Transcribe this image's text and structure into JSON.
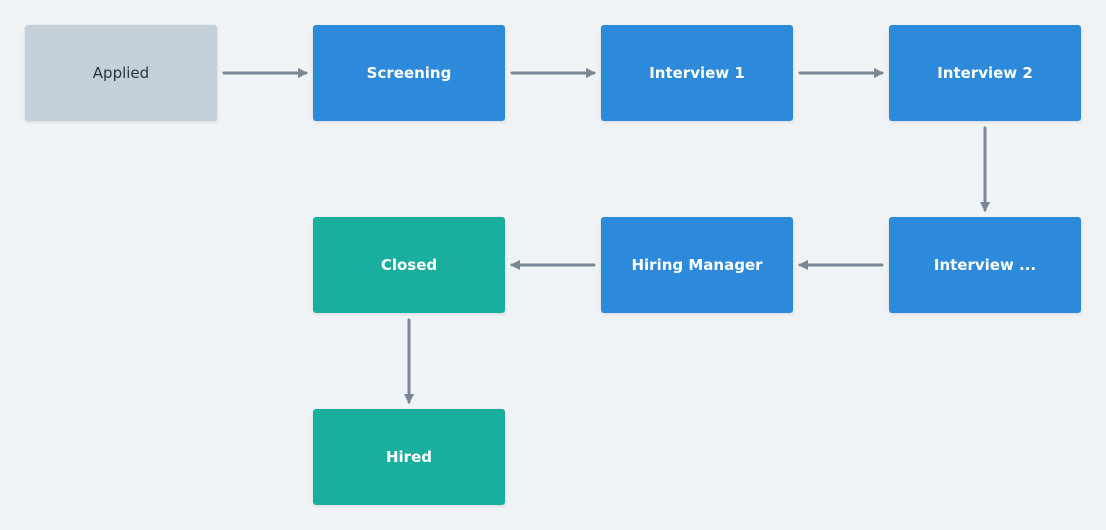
{
  "colors": {
    "pending": "#c4cfd8",
    "active": "#2d89d9",
    "final": "#1aae9f",
    "arrow": "#7b8794",
    "background": "#f0f3f6"
  },
  "nodes": [
    {
      "id": "applied",
      "label": "Applied",
      "status": "pending"
    },
    {
      "id": "screening",
      "label": "Screening",
      "status": "active"
    },
    {
      "id": "interview1",
      "label": "Interview 1",
      "status": "active"
    },
    {
      "id": "interview2",
      "label": "Interview 2",
      "status": "active"
    },
    {
      "id": "interview3",
      "label": "Interview ...",
      "status": "active"
    },
    {
      "id": "hiring-manager",
      "label": "Hiring Manager",
      "status": "active"
    },
    {
      "id": "closed",
      "label": "Closed",
      "status": "final"
    },
    {
      "id": "hired",
      "label": "Hired",
      "status": "final"
    }
  ],
  "edges": [
    {
      "from": "applied",
      "to": "screening"
    },
    {
      "from": "screening",
      "to": "interview1"
    },
    {
      "from": "interview1",
      "to": "interview2"
    },
    {
      "from": "interview2",
      "to": "interview3"
    },
    {
      "from": "interview3",
      "to": "hiring-manager"
    },
    {
      "from": "hiring-manager",
      "to": "closed"
    },
    {
      "from": "closed",
      "to": "hired"
    }
  ]
}
